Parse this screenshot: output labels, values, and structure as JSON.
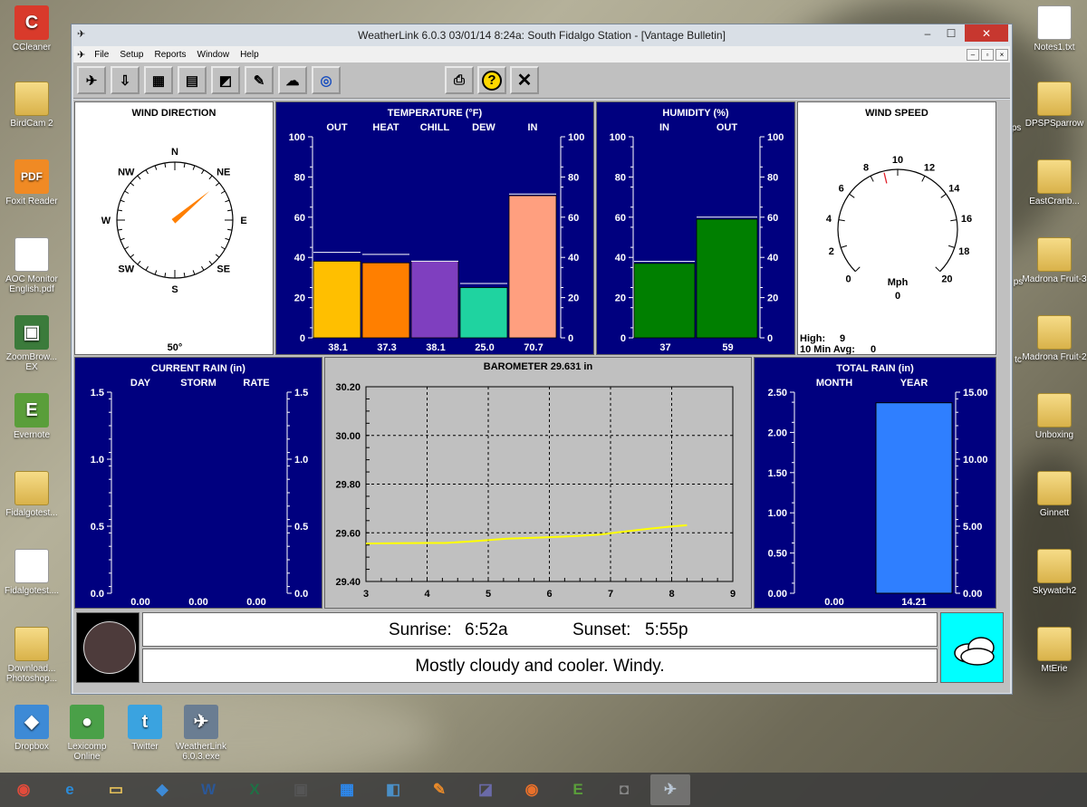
{
  "desktop": {
    "left_icons": [
      {
        "label": "CCleaner",
        "glyph": "C",
        "color": "#d93a2b"
      },
      {
        "label": "BirdCam 2",
        "glyph": "",
        "color": "folder"
      },
      {
        "label": "Foxit Reader",
        "glyph": "PDF",
        "color": "#f08a24"
      },
      {
        "label": "AOC Monitor English.pdf",
        "glyph": "",
        "color": "doc"
      },
      {
        "label": "ZoomBrow... EX",
        "glyph": "▣",
        "color": "#3b7b3b"
      },
      {
        "label": "Evernote",
        "glyph": "E",
        "color": "#5a9e3a"
      },
      {
        "label": "Fidalgotest...",
        "glyph": "",
        "color": "folder"
      },
      {
        "label": "Fidalgotest....",
        "glyph": "",
        "color": "doc"
      },
      {
        "label": "Download... Photoshop...",
        "glyph": "",
        "color": "folder"
      }
    ],
    "right_icons": [
      {
        "label": "Notes1.txt",
        "glyph": "",
        "color": "doc"
      },
      {
        "label": "DPSPSparrow",
        "glyph": "",
        "color": "folder"
      },
      {
        "label": "EastCranb...",
        "glyph": "",
        "color": "folder"
      },
      {
        "label": "Madrona Fruit-3",
        "glyph": "",
        "color": "folder"
      },
      {
        "label": "Madrona Fruit-2",
        "glyph": "",
        "color": "folder"
      },
      {
        "label": "Unboxing",
        "glyph": "",
        "color": "folder"
      },
      {
        "label": "Ginnett",
        "glyph": "",
        "color": "folder"
      },
      {
        "label": "Skywatch2",
        "glyph": "",
        "color": "folder"
      },
      {
        "label": "MtErie",
        "glyph": "",
        "color": "folder"
      }
    ],
    "bottom_icons": [
      {
        "label": "Dropbox",
        "glyph": "◆",
        "color": "#3d8ad6"
      },
      {
        "label": "Lexicomp Online",
        "glyph": "●",
        "color": "#4aa048"
      },
      {
        "label": "Twitter",
        "glyph": "t",
        "color": "#3aa3e0"
      },
      {
        "label": "WeatherLink 6.0.3.exe",
        "glyph": "✈",
        "color": "#6a7d92"
      }
    ],
    "partial_labels": [
      "ps",
      "tc"
    ]
  },
  "taskbar": {
    "buttons": [
      {
        "name": "chrome-icon",
        "glyph": "◉",
        "color": "#e24b3b"
      },
      {
        "name": "internet-explorer-icon",
        "glyph": "e",
        "color": "#2b8bd8"
      },
      {
        "name": "file-explorer-icon",
        "glyph": "▭",
        "color": "#e7c25a"
      },
      {
        "name": "dropbox-icon",
        "glyph": "◆",
        "color": "#3d8ad6"
      },
      {
        "name": "word-icon",
        "glyph": "W",
        "color": "#2b5797"
      },
      {
        "name": "excel-icon",
        "glyph": "X",
        "color": "#1e7145"
      },
      {
        "name": "photo-app-icon",
        "glyph": "▣",
        "color": "#555"
      },
      {
        "name": "app-icon",
        "glyph": "▦",
        "color": "#2d89ef"
      },
      {
        "name": "photoshop-elements-icon",
        "glyph": "◧",
        "color": "#4a8fc7"
      },
      {
        "name": "paint-icon",
        "glyph": "✎",
        "color": "#e98a2a"
      },
      {
        "name": "media-icon",
        "glyph": "◪",
        "color": "#6a6aa8"
      },
      {
        "name": "eye-app-icon",
        "glyph": "◉",
        "color": "#e9702a"
      },
      {
        "name": "evernote-icon",
        "glyph": "E",
        "color": "#5a9e3a"
      },
      {
        "name": "camera-app-icon",
        "glyph": "◘",
        "color": "#888"
      },
      {
        "name": "weatherlink-icon",
        "glyph": "✈",
        "color": "#b9c6d4"
      }
    ]
  },
  "window": {
    "title": "WeatherLink 6.0.3  03/01/14  8:24a: South Fidalgo Station - [Vantage Bulletin]",
    "minimize": "–",
    "maximize": "☐",
    "close": "✕",
    "menu": [
      "File",
      "Setup",
      "Reports",
      "Window",
      "Help"
    ],
    "mdi": [
      "–",
      "▫",
      "×"
    ]
  },
  "toolbar": {
    "buttons": [
      {
        "name": "station-icon",
        "glyph": "✈"
      },
      {
        "name": "download-icon",
        "glyph": "⇩"
      },
      {
        "name": "bulletin-icon",
        "glyph": "▦"
      },
      {
        "name": "summary-icon",
        "glyph": "▤"
      },
      {
        "name": "graph-icon",
        "glyph": "◩"
      },
      {
        "name": "notes-icon",
        "glyph": "✎"
      },
      {
        "name": "weather-icon",
        "glyph": "☁"
      },
      {
        "name": "noaa-icon",
        "glyph": "◎"
      }
    ],
    "print": "⎙",
    "help": "?",
    "exit": "✕"
  },
  "wind_direction": {
    "title": "WIND DIRECTION",
    "value": "50°",
    "degrees": 50,
    "labels": [
      "N",
      "NE",
      "E",
      "SE",
      "S",
      "SW",
      "W",
      "NW"
    ]
  },
  "temperature": {
    "title": "TEMPERATURE  (°F)",
    "scale_left": [
      "100",
      "80",
      "60",
      "40",
      "20",
      "0"
    ],
    "scale_right": [
      "100",
      "80",
      "60",
      "40",
      "20",
      "0"
    ],
    "bars": [
      {
        "label": "OUT",
        "value": "38.1",
        "v": 38.1,
        "high": 42.5,
        "color": "#ffbf00"
      },
      {
        "label": "HEAT",
        "value": "37.3",
        "v": 37.3,
        "high": 41.5,
        "color": "#ff7f00"
      },
      {
        "label": "CHILL",
        "value": "38.1",
        "v": 38.1,
        "high": 38.1,
        "color": "#7f3fbf"
      },
      {
        "label": "DEW",
        "value": "25.0",
        "v": 25.0,
        "high": 27.0,
        "color": "#1fd3a0"
      },
      {
        "label": "IN",
        "value": "70.7",
        "v": 70.7,
        "high": 71.5,
        "color": "#ff9f7f"
      }
    ]
  },
  "humidity": {
    "title": "HUMIDITY  (%)",
    "scale_left": [
      "100",
      "80",
      "60",
      "40",
      "20",
      "0"
    ],
    "scale_right": [
      "100",
      "80",
      "60",
      "40",
      "20",
      "0"
    ],
    "bars": [
      {
        "label": "IN",
        "value": "37",
        "v": 37,
        "high": 38,
        "color": "#007f00"
      },
      {
        "label": "OUT",
        "value": "59",
        "v": 59,
        "high": 60,
        "color": "#007f00"
      }
    ]
  },
  "wind_speed": {
    "title": "WIND SPEED",
    "unit": "Mph",
    "value": "0",
    "needle": 9,
    "ticks": [
      "0",
      "2",
      "4",
      "6",
      "8",
      "10",
      "12",
      "14",
      "16",
      "18",
      "20"
    ],
    "high_label": "High:",
    "high": "9",
    "avg_label": "10 Min Avg:",
    "avg": "0"
  },
  "current_rain": {
    "title": "CURRENT RAIN  (in)",
    "columns": [
      "DAY",
      "STORM",
      "RATE"
    ],
    "values": [
      "0.00",
      "0.00",
      "0.00"
    ],
    "scale_left": [
      "1.5",
      "1.0",
      "0.5",
      "0.0"
    ],
    "scale_right": [
      "1.5",
      "1.0",
      "0.5",
      "0.0"
    ]
  },
  "barometer": {
    "title": "BAROMETER 29.631 in",
    "y_ticks": [
      "30.20",
      "30.00",
      "29.80",
      "29.60",
      "29.40"
    ],
    "x_ticks": [
      "3",
      "4",
      "5",
      "6",
      "7",
      "8",
      "9"
    ],
    "ylim": [
      29.4,
      30.2
    ],
    "xlim": [
      3,
      9
    ],
    "series": [
      {
        "x": 3.0,
        "y": 29.556
      },
      {
        "x": 3.5,
        "y": 29.557
      },
      {
        "x": 4.0,
        "y": 29.558
      },
      {
        "x": 4.3,
        "y": 29.558
      },
      {
        "x": 4.8,
        "y": 29.566
      },
      {
        "x": 5.3,
        "y": 29.576
      },
      {
        "x": 5.8,
        "y": 29.58
      },
      {
        "x": 6.3,
        "y": 29.585
      },
      {
        "x": 6.8,
        "y": 29.592
      },
      {
        "x": 7.2,
        "y": 29.604
      },
      {
        "x": 7.6,
        "y": 29.616
      },
      {
        "x": 8.0,
        "y": 29.626
      },
      {
        "x": 8.25,
        "y": 29.631
      }
    ]
  },
  "total_rain": {
    "title": "TOTAL RAIN  (in)",
    "columns": [
      "MONTH",
      "YEAR"
    ],
    "values": [
      "0.00",
      "14.21"
    ],
    "year_value": 14.21,
    "scale_left": [
      "2.50",
      "2.00",
      "1.50",
      "1.00",
      "0.50",
      "0.00"
    ],
    "scale_right": [
      "15.00",
      "10.00",
      "5.00",
      "0.00"
    ],
    "year_max": 15
  },
  "bottom": {
    "sunrise_label": "Sunrise:",
    "sunrise": "6:52a",
    "sunset_label": "Sunset:",
    "sunset": "5:55p",
    "forecast": "Mostly cloudy and cooler.  Windy."
  },
  "colors": {
    "navy": "#00007f",
    "forecast_bg": "#00ffff",
    "barometer_line": "#ffff00"
  }
}
